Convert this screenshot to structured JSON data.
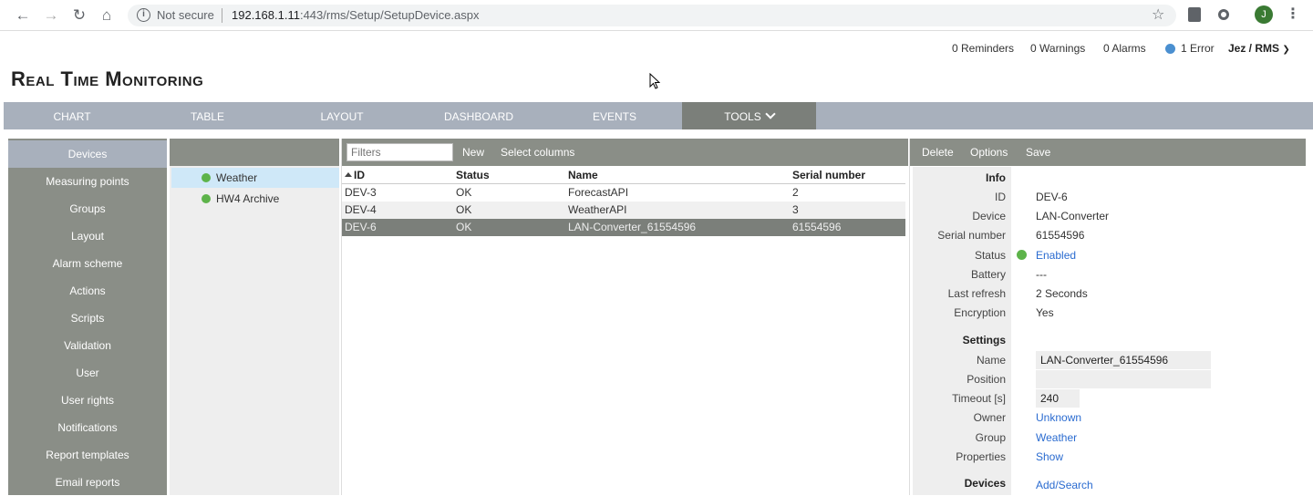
{
  "browser": {
    "security": "Not secure",
    "url_host": "192.168.1.11",
    "url_rest": ":443/rms/Setup/SetupDevice.aspx",
    "avatar_letter": "J"
  },
  "header": {
    "reminders": "0 Reminders",
    "warnings": "0 Warnings",
    "alarms": "0 Alarms",
    "errors": "1 Error",
    "user": "Jez / RMS",
    "title": "Real Time Monitoring"
  },
  "tabs": [
    {
      "label": "CHART"
    },
    {
      "label": "TABLE"
    },
    {
      "label": "LAYOUT"
    },
    {
      "label": "DASHBOARD"
    },
    {
      "label": "EVENTS"
    },
    {
      "label": "TOOLS"
    }
  ],
  "sidebar": {
    "items": [
      {
        "label": "Devices"
      },
      {
        "label": "Measuring points"
      },
      {
        "label": "Groups"
      },
      {
        "label": "Layout"
      },
      {
        "label": "Alarm scheme"
      },
      {
        "label": "Actions"
      },
      {
        "label": "Scripts"
      },
      {
        "label": "Validation"
      },
      {
        "label": "User"
      },
      {
        "label": "User rights"
      },
      {
        "label": "Notifications"
      },
      {
        "label": "Report templates"
      },
      {
        "label": "Email reports"
      }
    ]
  },
  "groups": [
    {
      "label": "Weather",
      "status_color": "#5db34a"
    },
    {
      "label": "HW4 Archive",
      "status_color": "#5db34a"
    }
  ],
  "devices_toolbar": {
    "filter_placeholder": "Filters",
    "new_label": "New",
    "columns_label": "Select columns"
  },
  "device_table": {
    "columns": [
      "ID",
      "Status",
      "Name",
      "Serial number"
    ],
    "rows": [
      {
        "id": "DEV-3",
        "status": "OK",
        "name": "ForecastAPI",
        "serial": "2"
      },
      {
        "id": "DEV-4",
        "status": "OK",
        "name": "WeatherAPI",
        "serial": "3"
      },
      {
        "id": "DEV-6",
        "status": "OK",
        "name": "LAN-Converter_61554596",
        "serial": "61554596"
      }
    ]
  },
  "detail_toolbar": {
    "delete_label": "Delete",
    "options_label": "Options",
    "save_label": "Save"
  },
  "detail": {
    "info_title": "Info",
    "id_label": "ID",
    "id_value": "DEV-6",
    "device_label": "Device",
    "device_value": "LAN-Converter",
    "serial_label": "Serial number",
    "serial_value": "61554596",
    "status_label": "Status",
    "status_value": "Enabled",
    "battery_label": "Battery",
    "battery_value": "---",
    "refresh_label": "Last refresh",
    "refresh_value": "2 Seconds",
    "encryption_label": "Encryption",
    "encryption_value": "Yes",
    "settings_title": "Settings",
    "name_label": "Name",
    "name_value": "LAN-Converter_61554596",
    "position_label": "Position",
    "position_value": "",
    "timeout_label": "Timeout [s]",
    "timeout_value": "240",
    "owner_label": "Owner",
    "owner_value": "Unknown",
    "group_label": "Group",
    "group_value": "Weather",
    "properties_label": "Properties",
    "properties_value": "Show",
    "devices_title": "Devices",
    "devices_value": "Add/Search"
  },
  "colors": {
    "tabbar": "#a8b0bc",
    "panel_header": "#8a8e87",
    "selected_row": "#7b7f7a",
    "link": "#2a6bd0",
    "status_ok": "#5db34a",
    "error_dot": "#4a8fd0"
  }
}
